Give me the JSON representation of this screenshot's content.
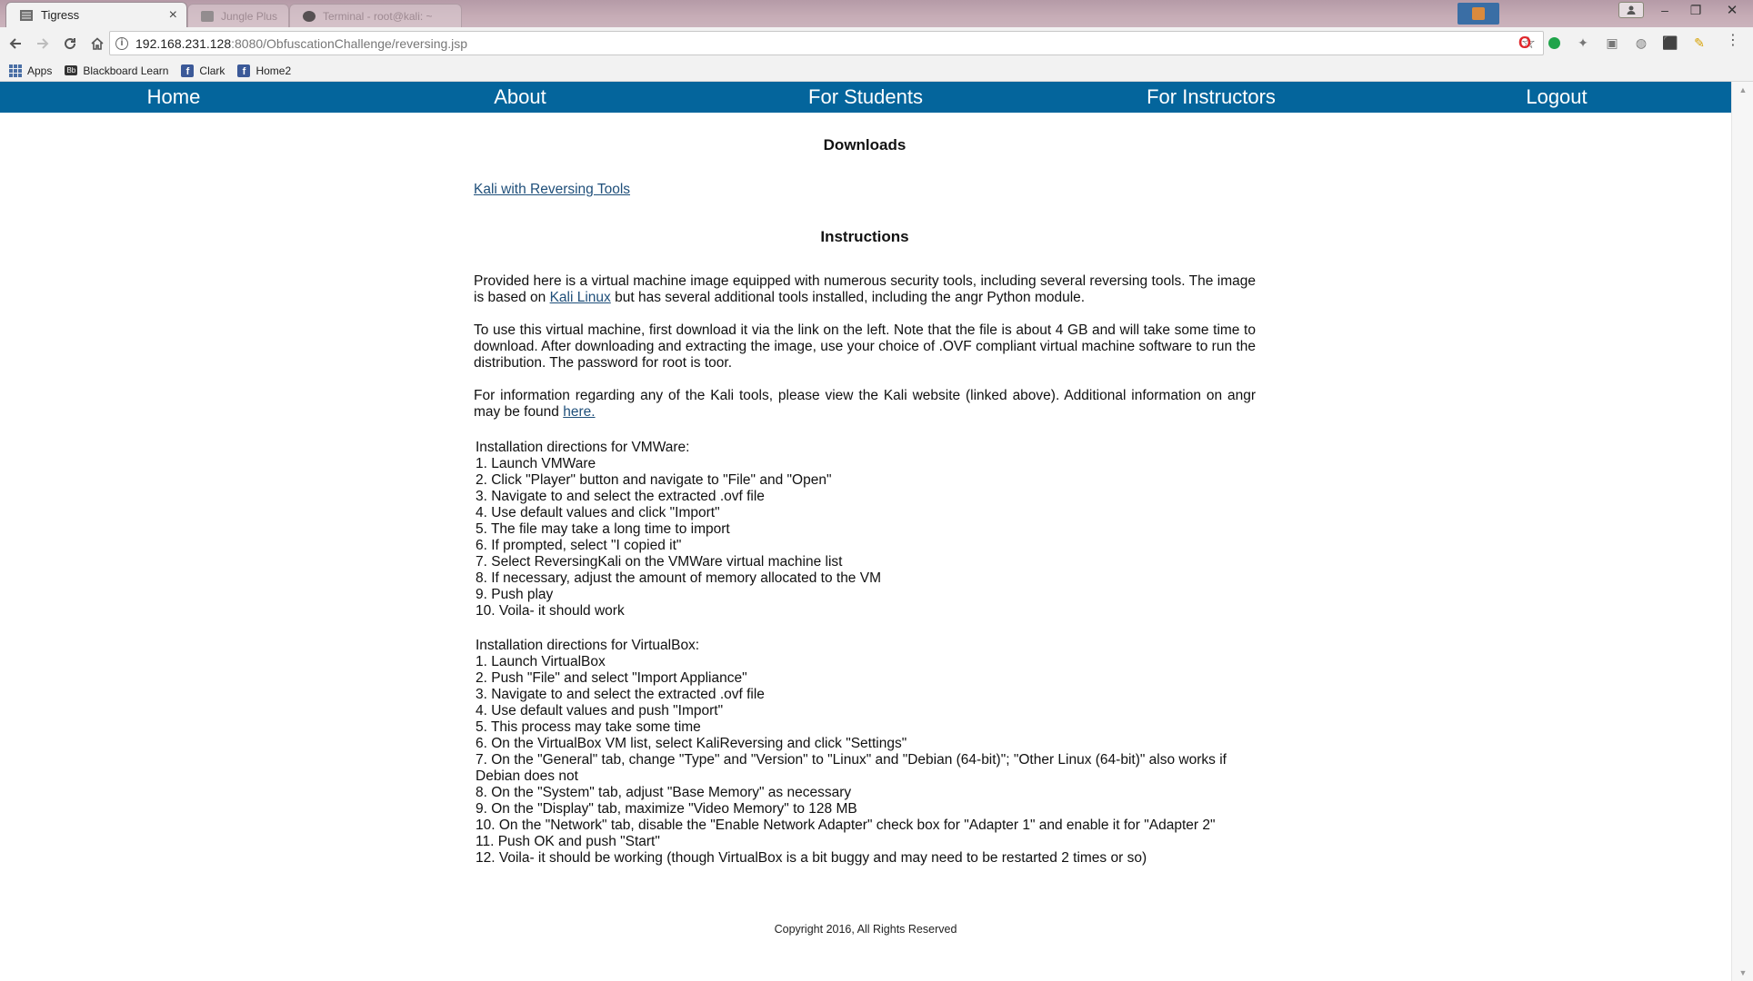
{
  "browser": {
    "active_tab": {
      "title": "Tigress",
      "close": "×"
    },
    "background_tabs": [
      {
        "title": "Jungle Plus"
      },
      {
        "title": "Terminal - root@kali: ~"
      }
    ],
    "window_controls": {
      "minimize": "–",
      "restore": "❐",
      "close": "✕"
    },
    "address": {
      "host": "192.168.231.128",
      "path": ":8080/ObfuscationChallenge/reversing.jsp"
    },
    "bookmarks": [
      {
        "label": "Apps",
        "icon": "apps-grid-icon"
      },
      {
        "label": "Blackboard Learn",
        "icon": "blackboard-icon"
      },
      {
        "label": "Clark",
        "icon": "facebook-icon"
      },
      {
        "label": "Home2",
        "icon": "facebook-icon"
      }
    ],
    "colors": {
      "tabstrip": "#c6acb6",
      "toolbar": "#f2f2f2"
    }
  },
  "site": {
    "nav": [
      {
        "label": "Home"
      },
      {
        "label": "About"
      },
      {
        "label": "For Students"
      },
      {
        "label": "For Instructors"
      },
      {
        "label": "Logout"
      }
    ],
    "nav_color": "#04659c",
    "downloads_title": "Downloads",
    "download_link": "Kali with Reversing Tools",
    "instructions_title": "Instructions",
    "para1": {
      "before": "Provided here is a virtual machine image equipped with numerous security tools, including several reversing tools. The image is based on ",
      "link": "Kali Linux",
      "after": " but has several additional tools installed, including the angr Python module."
    },
    "para2": "To use this virtual machine, first download it via the link on the left. Note that the file is about 4 GB and will take some time to download. After downloading and extracting the image, use your choice of .OVF compliant virtual machine software to run the distribution. The password for root is toor.",
    "para3": {
      "before": "For information regarding any of the Kali tools, please view the Kali website (linked above). Additional information on angr may be found ",
      "link": "here."
    },
    "vmware": {
      "heading": "Installation directions for VMWare:",
      "steps": [
        "1. Launch VMWare",
        "2. Click \"Player\" button and navigate to \"File\" and \"Open\"",
        "3. Navigate to and select the extracted .ovf file",
        "4. Use default values and click \"Import\"",
        "5. The file may take a long time to import",
        "6. If prompted, select \"I copied it\"",
        "7. Select ReversingKali on the VMWare virtual machine list",
        "8. If necessary, adjust the amount of memory allocated to the VM",
        "9. Push play",
        "10. Voila- it should work"
      ]
    },
    "virtualbox": {
      "heading": "Installation directions for VirtualBox:",
      "steps": [
        "1. Launch VirtualBox",
        "2. Push \"File\" and select \"Import Appliance\"",
        "3. Navigate to and select the extracted .ovf file",
        "4. Use default values and push \"Import\"",
        "5. This process may take some time",
        "6. On the VirtualBox VM list, select KaliReversing and click \"Settings\"",
        "7. On the \"General\" tab, change \"Type\" and \"Version\" to \"Linux\" and \"Debian (64-bit)\"; \"Other Linux (64-bit)\" also works if Debian does not",
        "8. On the \"System\" tab, adjust \"Base Memory\" as necessary",
        "9. On the \"Display\" tab, maximize \"Video Memory\" to 128 MB",
        "10. On the \"Network\" tab, disable the \"Enable Network Adapter\" check box for \"Adapter 1\" and enable it for \"Adapter 2\"",
        "11. Push OK and push \"Start\"",
        "12. Voila- it should be working (though VirtualBox is a bit buggy and may need to be restarted 2 times or so)"
      ]
    },
    "copyright": "Copyright 2016, All Rights Reserved"
  }
}
